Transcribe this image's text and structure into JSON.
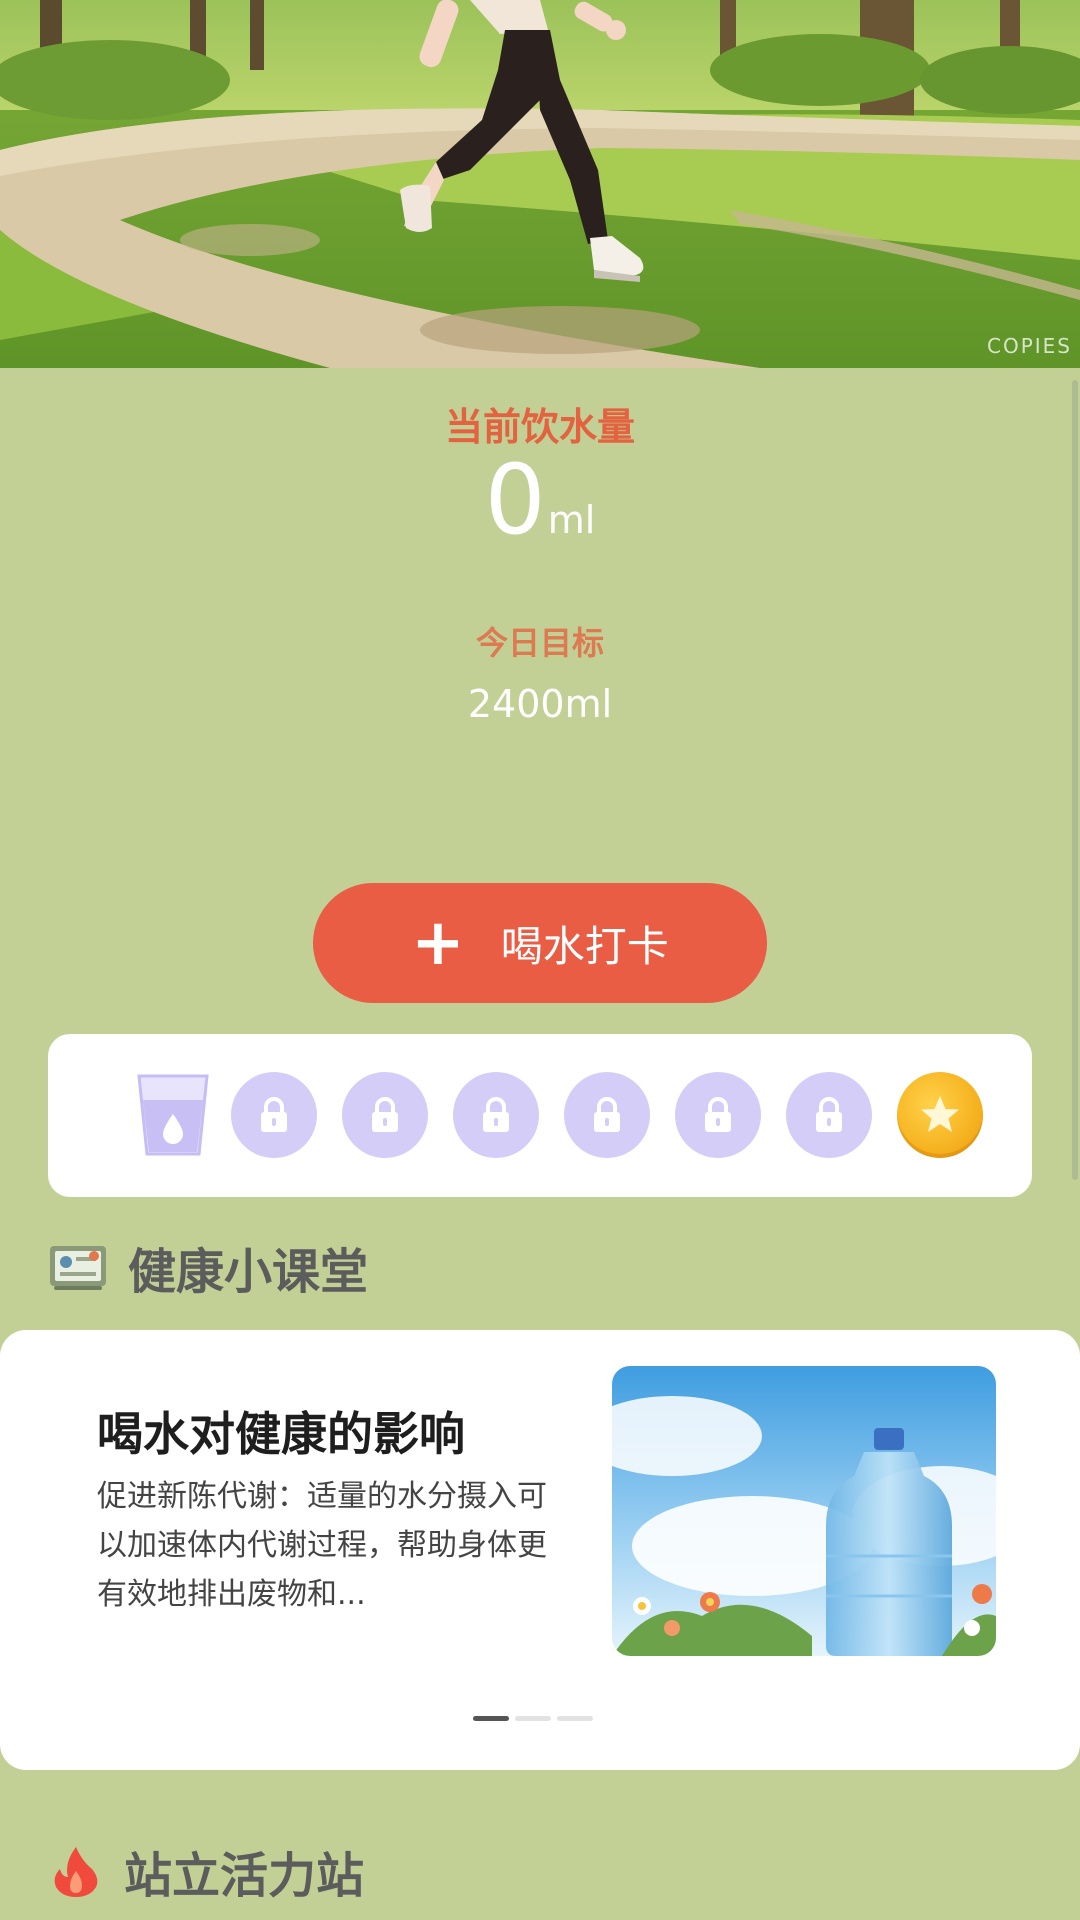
{
  "hero": {
    "watermark": "COPIES"
  },
  "water": {
    "current_label": "当前饮水量",
    "current_value": "0",
    "current_unit": "ml",
    "goal_label": "今日目标",
    "goal_value": "2400ml"
  },
  "checkin_button": {
    "icon": "plus-icon",
    "label": "喝水打卡"
  },
  "progress": {
    "slots": [
      "water-cup-icon",
      "lock-icon",
      "lock-icon",
      "lock-icon",
      "lock-icon",
      "lock-icon",
      "lock-icon",
      "star-coin-icon"
    ]
  },
  "health_section": {
    "icon": "classroom-board-icon",
    "title": "健康小课堂",
    "article": {
      "title": "喝水对健康的影响",
      "body": "促进新陈代谢：适量的水分摄入可以加速体内代谢过程，帮助身体更有效地排出废物和...",
      "image": "water-bottle-illustration"
    },
    "pager": {
      "count": 3,
      "active_index": 0
    }
  },
  "stand_section": {
    "icon": "fire-icon",
    "title": "站立活力站"
  },
  "colors": {
    "background": "#c2d096",
    "accent": "#e85d43",
    "lock_slot": "#d4cdf7",
    "coin": "#f6b321"
  }
}
